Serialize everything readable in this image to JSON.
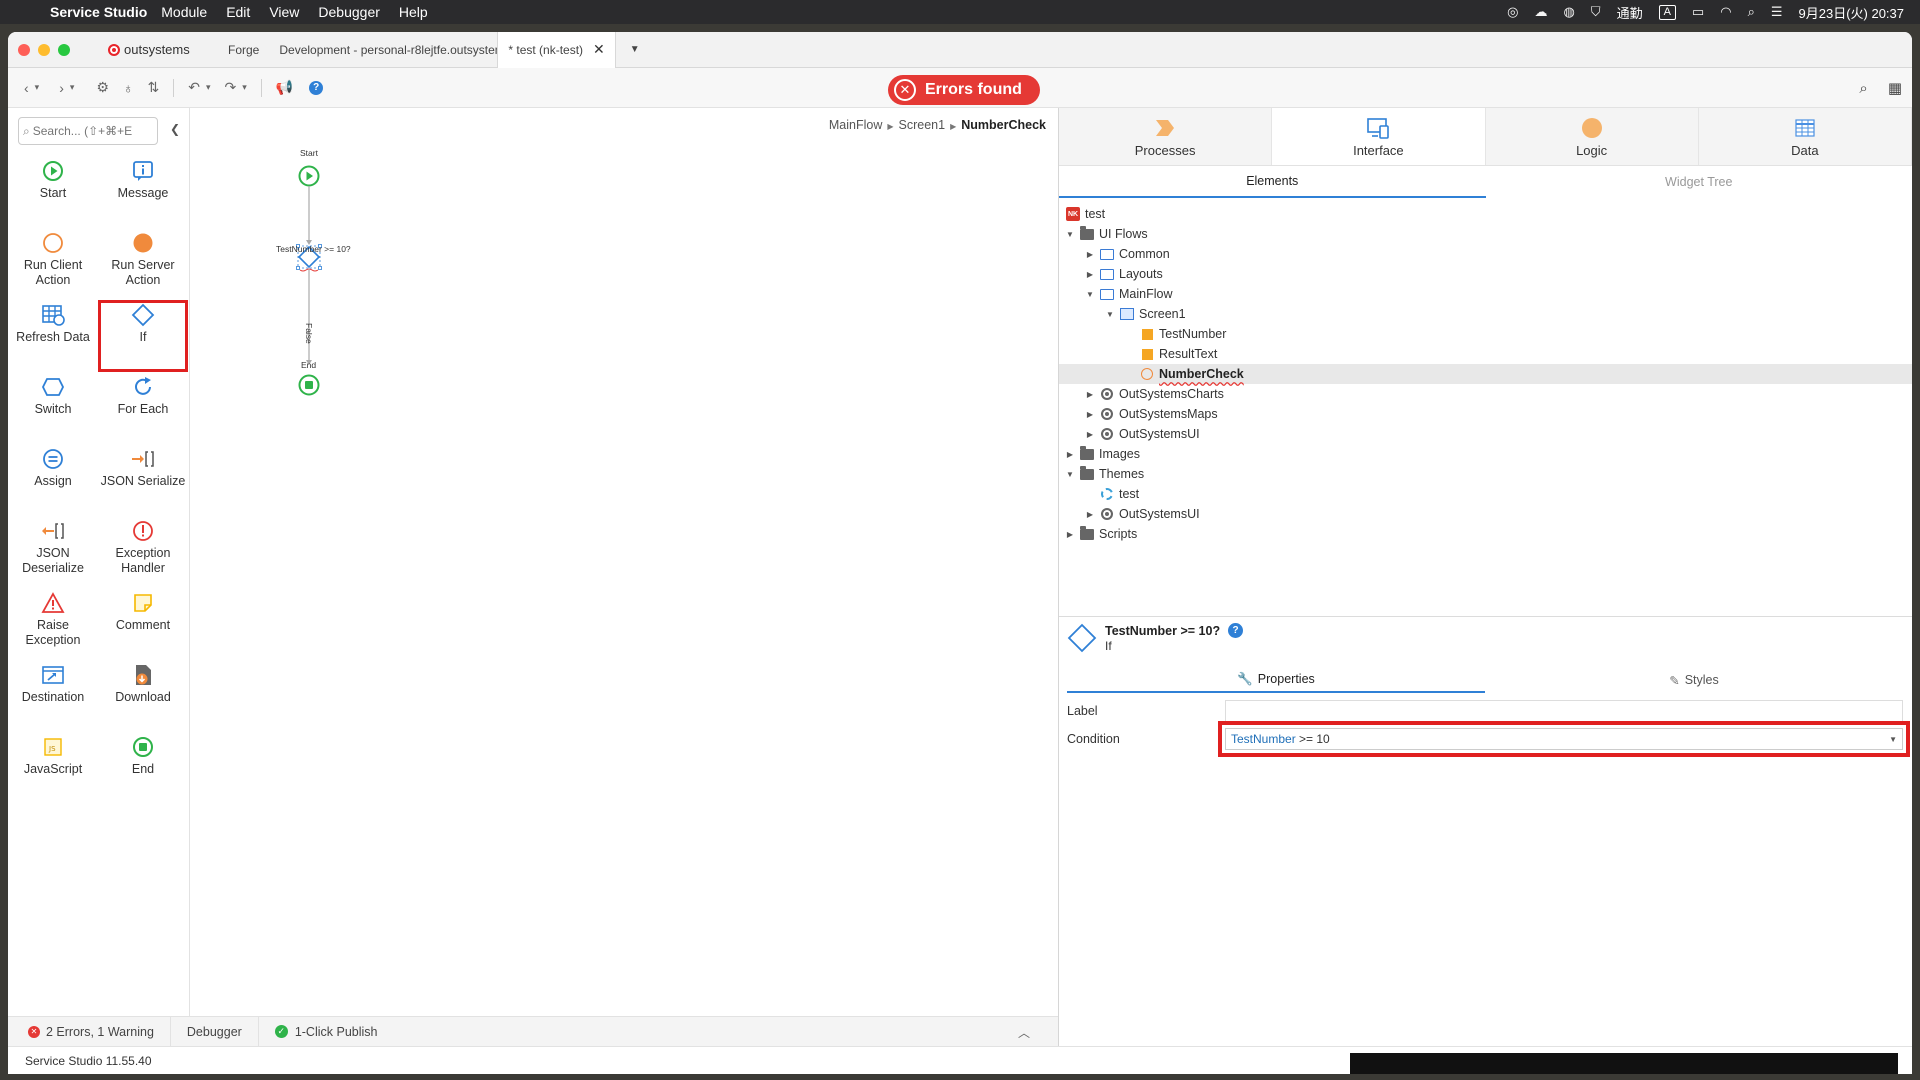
{
  "menubar": {
    "app": "Service Studio",
    "items": [
      "Module",
      "Edit",
      "View",
      "Debugger",
      "Help"
    ],
    "status_label": "通勤",
    "input_indicator": "A",
    "clock": "9月23日(火) 20:37"
  },
  "tabs": {
    "brand": "outsystems",
    "items": [
      {
        "label": "Forge"
      },
      {
        "label": "Development - personal-r8lejtfe.outsystemscloud.com"
      },
      {
        "label": "* test (nk-test)"
      }
    ]
  },
  "toolbar": {
    "errors_badge": "Errors found",
    "help_glyph": "?"
  },
  "toolbox": {
    "search_placeholder": "Search... (⇧+⌘+E",
    "tools": [
      {
        "label": "Start",
        "icon": "start-icon"
      },
      {
        "label": "Message",
        "icon": "message-icon"
      },
      {
        "label": "Run Client Action",
        "icon": "run-client-action-icon"
      },
      {
        "label": "Run Server Action",
        "icon": "run-server-action-icon"
      },
      {
        "label": "Refresh Data",
        "icon": "refresh-data-icon"
      },
      {
        "label": "If",
        "icon": "if-icon"
      },
      {
        "label": "Switch",
        "icon": "switch-icon"
      },
      {
        "label": "For Each",
        "icon": "for-each-icon"
      },
      {
        "label": "Assign",
        "icon": "assign-icon"
      },
      {
        "label": "JSON Serialize",
        "icon": "json-serialize-icon"
      },
      {
        "label": "JSON Deserialize",
        "icon": "json-deserialize-icon"
      },
      {
        "label": "Exception Handler",
        "icon": "exception-handler-icon"
      },
      {
        "label": "Raise Exception",
        "icon": "raise-exception-icon"
      },
      {
        "label": "Comment",
        "icon": "comment-icon"
      },
      {
        "label": "Destination",
        "icon": "destination-icon"
      },
      {
        "label": "Download",
        "icon": "download-icon"
      },
      {
        "label": "JavaScript",
        "icon": "javascript-icon"
      },
      {
        "label": "End",
        "icon": "end-icon"
      }
    ]
  },
  "canvas": {
    "breadcrumb": [
      "MainFlow",
      "Screen1",
      "NumberCheck"
    ],
    "flow": {
      "start_label": "Start",
      "if_label": "TestNumber >= 10?",
      "false_label": "False",
      "end_label": "End"
    }
  },
  "right_panel": {
    "tabs": [
      "Processes",
      "Interface",
      "Logic",
      "Data"
    ],
    "subtabs": [
      "Elements",
      "Widget Tree"
    ],
    "tree": [
      {
        "label": "test"
      },
      {
        "label": "UI Flows"
      },
      {
        "label": "Common"
      },
      {
        "label": "Layouts"
      },
      {
        "label": "MainFlow"
      },
      {
        "label": "Screen1"
      },
      {
        "label": "TestNumber"
      },
      {
        "label": "ResultText"
      },
      {
        "label": "NumberCheck"
      },
      {
        "label": "OutSystemsCharts"
      },
      {
        "label": "OutSystemsMaps"
      },
      {
        "label": "OutSystemsUI"
      },
      {
        "label": "Images"
      },
      {
        "label": "Themes"
      },
      {
        "label": "test"
      },
      {
        "label": "OutSystemsUI"
      },
      {
        "label": "Scripts"
      }
    ],
    "app_icon_text": "NK",
    "properties": {
      "title": "TestNumber >= 10?",
      "type": "If",
      "help_glyph": "?",
      "tabs": [
        "Properties",
        "Styles"
      ],
      "label_field": {
        "label": "Label",
        "value": ""
      },
      "condition_field": {
        "label": "Condition",
        "var": "TestNumber",
        "op": " >= 10"
      }
    }
  },
  "bottom": {
    "errors": "2 Errors, 1 Warning",
    "debugger": "Debugger",
    "publish": "1-Click Publish",
    "version": "Service Studio 11.55.40"
  }
}
